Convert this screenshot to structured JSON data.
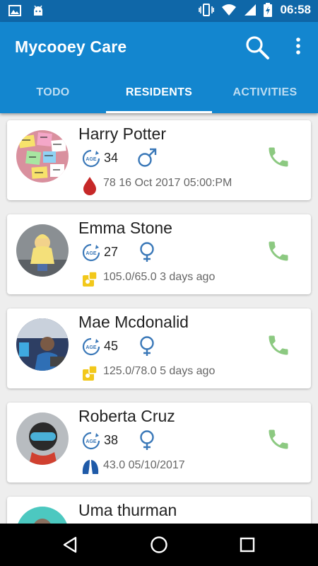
{
  "status_bar": {
    "time": "06:58"
  },
  "app": {
    "title": "Mycooey Care"
  },
  "colors": {
    "appbar": "#1386cf",
    "statusbar": "#0f67a8",
    "call": "#8cc981",
    "icon_blue": "#3a78b8",
    "blood": "#c62828",
    "bp_yellow": "#f2c81b"
  },
  "tabs": [
    {
      "label": "TODO",
      "active": false
    },
    {
      "label": "RESIDENTS",
      "active": true
    },
    {
      "label": "ACTIVITIES",
      "active": false
    }
  ],
  "residents": [
    {
      "name": "Harry Potter",
      "age": "34",
      "gender": "male",
      "vital_icon": "blood-drop-icon",
      "vital": "78  16 Oct 2017 05:00:PM"
    },
    {
      "name": "Emma Stone",
      "age": "27",
      "gender": "female",
      "vital_icon": "blood-pressure-icon",
      "vital": "105.0/65.0  3 days ago"
    },
    {
      "name": "Mae Mcdonalid",
      "age": "45",
      "gender": "female",
      "vital_icon": "blood-pressure-icon",
      "vital": "125.0/78.0  5 days ago"
    },
    {
      "name": "Roberta Cruz",
      "age": "38",
      "gender": "female",
      "vital_icon": "lungs-icon",
      "vital": "43.0 05/10/2017"
    },
    {
      "name": "Uma thurman",
      "age": "",
      "gender": "",
      "vital_icon": "",
      "vital": ""
    }
  ],
  "age_icon_text": "AGE"
}
